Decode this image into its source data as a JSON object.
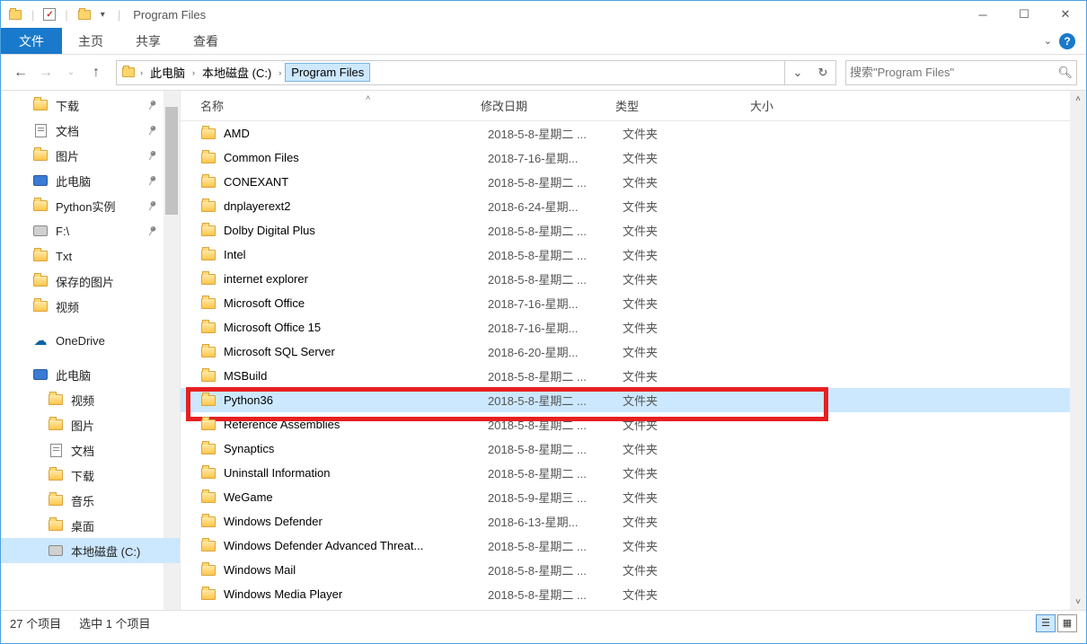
{
  "window": {
    "title": "Program Files"
  },
  "ribbon": {
    "file": "文件",
    "tabs": [
      "主页",
      "共享",
      "查看"
    ]
  },
  "address": {
    "crumbs": [
      "此电脑",
      "本地磁盘 (C:)",
      "Program Files"
    ]
  },
  "search": {
    "placeholder": "搜索\"Program Files\""
  },
  "columns": {
    "name": "名称",
    "date": "修改日期",
    "type": "类型",
    "size": "大小"
  },
  "sidebar": {
    "quick": [
      {
        "label": "下载",
        "pin": true,
        "ico": "folder"
      },
      {
        "label": "文档",
        "pin": true,
        "ico": "doc"
      },
      {
        "label": "图片",
        "pin": true,
        "ico": "folder"
      },
      {
        "label": "此电脑",
        "pin": true,
        "ico": "pc"
      },
      {
        "label": "Python实例",
        "pin": true,
        "ico": "folder"
      },
      {
        "label": "F:\\",
        "pin": true,
        "ico": "disk"
      },
      {
        "label": "Txt",
        "pin": false,
        "ico": "folder"
      },
      {
        "label": "保存的图片",
        "pin": false,
        "ico": "folder"
      },
      {
        "label": "视频",
        "pin": false,
        "ico": "folder"
      }
    ],
    "onedrive": "OneDrive",
    "thispc": "此电脑",
    "thispc_children": [
      {
        "label": "视频",
        "ico": "folder"
      },
      {
        "label": "图片",
        "ico": "folder"
      },
      {
        "label": "文档",
        "ico": "doc"
      },
      {
        "label": "下载",
        "ico": "folder"
      },
      {
        "label": "音乐",
        "ico": "folder"
      },
      {
        "label": "桌面",
        "ico": "folder"
      },
      {
        "label": "本地磁盘 (C:)",
        "ico": "disk",
        "sel": true
      }
    ]
  },
  "files": [
    {
      "name": "AMD",
      "date": "2018-5-8-星期二 ...",
      "type": "文件夹"
    },
    {
      "name": "Common Files",
      "date": "2018-7-16-星期...",
      "type": "文件夹"
    },
    {
      "name": "CONEXANT",
      "date": "2018-5-8-星期二 ...",
      "type": "文件夹"
    },
    {
      "name": "dnplayerext2",
      "date": "2018-6-24-星期...",
      "type": "文件夹"
    },
    {
      "name": "Dolby Digital Plus",
      "date": "2018-5-8-星期二 ...",
      "type": "文件夹"
    },
    {
      "name": "Intel",
      "date": "2018-5-8-星期二 ...",
      "type": "文件夹"
    },
    {
      "name": "internet explorer",
      "date": "2018-5-8-星期二 ...",
      "type": "文件夹"
    },
    {
      "name": "Microsoft Office",
      "date": "2018-7-16-星期...",
      "type": "文件夹"
    },
    {
      "name": "Microsoft Office 15",
      "date": "2018-7-16-星期...",
      "type": "文件夹"
    },
    {
      "name": "Microsoft SQL Server",
      "date": "2018-6-20-星期...",
      "type": "文件夹"
    },
    {
      "name": "MSBuild",
      "date": "2018-5-8-星期二 ...",
      "type": "文件夹"
    },
    {
      "name": "Python36",
      "date": "2018-5-8-星期二 ...",
      "type": "文件夹",
      "sel": true
    },
    {
      "name": "Reference Assemblies",
      "date": "2018-5-8-星期二 ...",
      "type": "文件夹"
    },
    {
      "name": "Synaptics",
      "date": "2018-5-8-星期二 ...",
      "type": "文件夹"
    },
    {
      "name": "Uninstall Information",
      "date": "2018-5-8-星期二 ...",
      "type": "文件夹"
    },
    {
      "name": "WeGame",
      "date": "2018-5-9-星期三 ...",
      "type": "文件夹"
    },
    {
      "name": "Windows Defender",
      "date": "2018-6-13-星期...",
      "type": "文件夹"
    },
    {
      "name": "Windows Defender Advanced Threat...",
      "date": "2018-5-8-星期二 ...",
      "type": "文件夹"
    },
    {
      "name": "Windows Mail",
      "date": "2018-5-8-星期二 ...",
      "type": "文件夹"
    },
    {
      "name": "Windows Media Player",
      "date": "2018-5-8-星期二 ...",
      "type": "文件夹"
    }
  ],
  "status": {
    "count": "27 个项目",
    "selected": "选中 1 个项目"
  }
}
